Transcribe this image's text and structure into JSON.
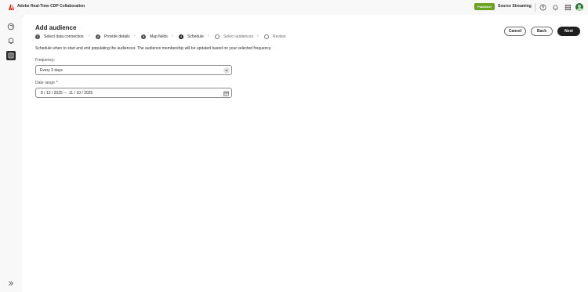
{
  "app": {
    "title": "Adobe Real-Time CDP Collaboration"
  },
  "header": {
    "badge": "Publisher",
    "org_name": "Source Streaming",
    "icons": [
      "help-icon",
      "bell-icon",
      "apps-grid-icon",
      "avatar"
    ]
  },
  "sidenav": {
    "items": [
      "home-icon",
      "bell-icon",
      "audiences-icon"
    ],
    "active": "audiences-icon"
  },
  "page": {
    "title": "Add audience",
    "steps": [
      {
        "number": "1",
        "label": "Select data connection",
        "state": "done"
      },
      {
        "number": "2",
        "label": "Provide details",
        "state": "done"
      },
      {
        "number": "3",
        "label": "Map fields",
        "state": "done"
      },
      {
        "number": "4",
        "label": "Schedule",
        "state": "current"
      },
      {
        "number": "",
        "label": "Select audiences",
        "state": "todo"
      },
      {
        "number": "",
        "label": "Review",
        "state": "todo"
      }
    ],
    "buttons": {
      "cancel": "Cancel",
      "back": "Back",
      "next": "Next"
    },
    "description": "Schedule when to start and end populating the audiences. The audience membership will be updated based on your selected frequency.",
    "frequency": {
      "label": "Frequency:",
      "value": "Every 3 days"
    },
    "date_range": {
      "label": "Date range",
      "required_marker": "*",
      "start": "8 / 12 / 2025",
      "separator": "–",
      "end": "11 / 10 / 2025"
    }
  },
  "colors": {
    "badge": "#6aa322",
    "primary_button": "#1f1f1f",
    "adobe_red": "#eb1000"
  }
}
